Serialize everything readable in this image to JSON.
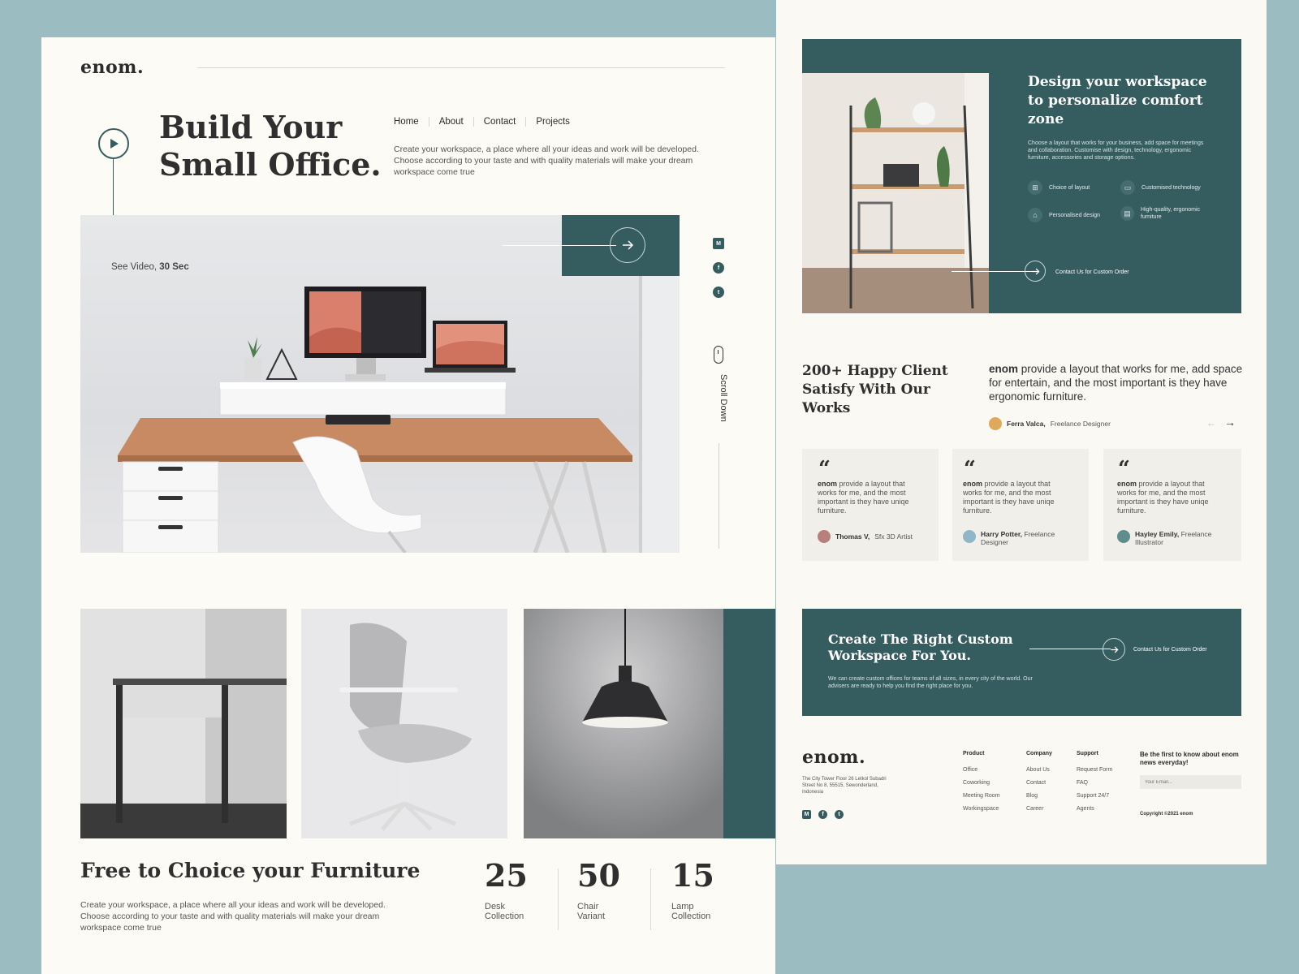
{
  "brand": {
    "logo": "enom."
  },
  "hero": {
    "title_line1": "Build Your",
    "title_line2": "Small Office.",
    "video_label": "See Video,",
    "video_duration": "30 Sec",
    "description": "Create your workspace, a place where all your ideas and work will be developed. Choose according to your taste and with quality materials will make your dream workspace come true"
  },
  "nav": {
    "items": [
      "Home",
      "About",
      "Contact",
      "Projects"
    ]
  },
  "social": {
    "icons": [
      "medium-icon",
      "facebook-icon",
      "twitter-icon"
    ]
  },
  "scroll": {
    "label": "Scroll Down"
  },
  "furniture": {
    "title": "Free to Choice your Furniture",
    "description": "Create your workspace, a place where all your ideas and work will be developed. Choose according to your taste and with quality materials will make your dream workspace come true",
    "stats": [
      {
        "value": "25",
        "label1": "Desk",
        "label2": "Collection"
      },
      {
        "value": "50",
        "label1": "Chair",
        "label2": "Variant"
      },
      {
        "value": "15",
        "label1": "Lamp",
        "label2": "Collection"
      }
    ]
  },
  "design": {
    "title": "Design your workspace to personalize comfort zone",
    "description": "Choose a layout that works for your business, add space for meetings and collaboration. Customise with design, technology, ergonomic furniture, accessories and storage options.",
    "features": [
      "Choice of layout",
      "Customised technology",
      "Personalised design",
      "High-quality, ergonomic furniture"
    ],
    "cta": "Contact Us for Custom Order"
  },
  "testimonial": {
    "heading": "200+ Happy Client Satisfy With Our Works",
    "brand": "enom",
    "quote": "provide a layout that works for me, add space for entertain, and the most important is they have ergonomic furniture.",
    "author_name": "Ferra Valca,",
    "author_role": "Freelance Designer",
    "cards": [
      {
        "brand": "enom",
        "text": "provide a layout that works for me, and the most important is they have uniqe furniture.",
        "name": "Thomas V,",
        "role": "Sfx 3D Artist"
      },
      {
        "brand": "enom",
        "text": "provide a layout that works for me, and the most important is they have uniqe furniture.",
        "name": "Harry Potter,",
        "role": "Freelance Designer"
      },
      {
        "brand": "enom",
        "text": "provide a layout that works for me, and the most important is they have uniqe furniture.",
        "name": "Hayley Emily,",
        "role": "Freelance Illustrator"
      }
    ]
  },
  "custom": {
    "title": "Create The Right Custom Workspace For You.",
    "description": "We can create custom offices for teams of all sizes, in every city of the world. Our advisers are ready to help you find the right place for you.",
    "cta": "Contact Us for Custom Order"
  },
  "footer": {
    "address": "The City Tower Floor 26 Letkol Subadri Street No 8, 55515, Sewonderland, Indonesia",
    "columns": [
      {
        "title": "Product",
        "links": [
          "Office",
          "Coworking",
          "Meeting Room",
          "Workingspace"
        ]
      },
      {
        "title": "Company",
        "links": [
          "About Us",
          "Contact",
          "Blog",
          "Career"
        ]
      },
      {
        "title": "Support",
        "links": [
          "Request Form",
          "FAQ",
          "Support 24/7",
          "Agents"
        ]
      }
    ],
    "newsletter_title": "Be the first to know about enom news everyday!",
    "email_placeholder": "Your Email...",
    "copyright": "Copyright ©2021 enom"
  },
  "colors": {
    "teal": "#355d60",
    "background": "#9bbcc1",
    "page": "#fdfbf6"
  }
}
